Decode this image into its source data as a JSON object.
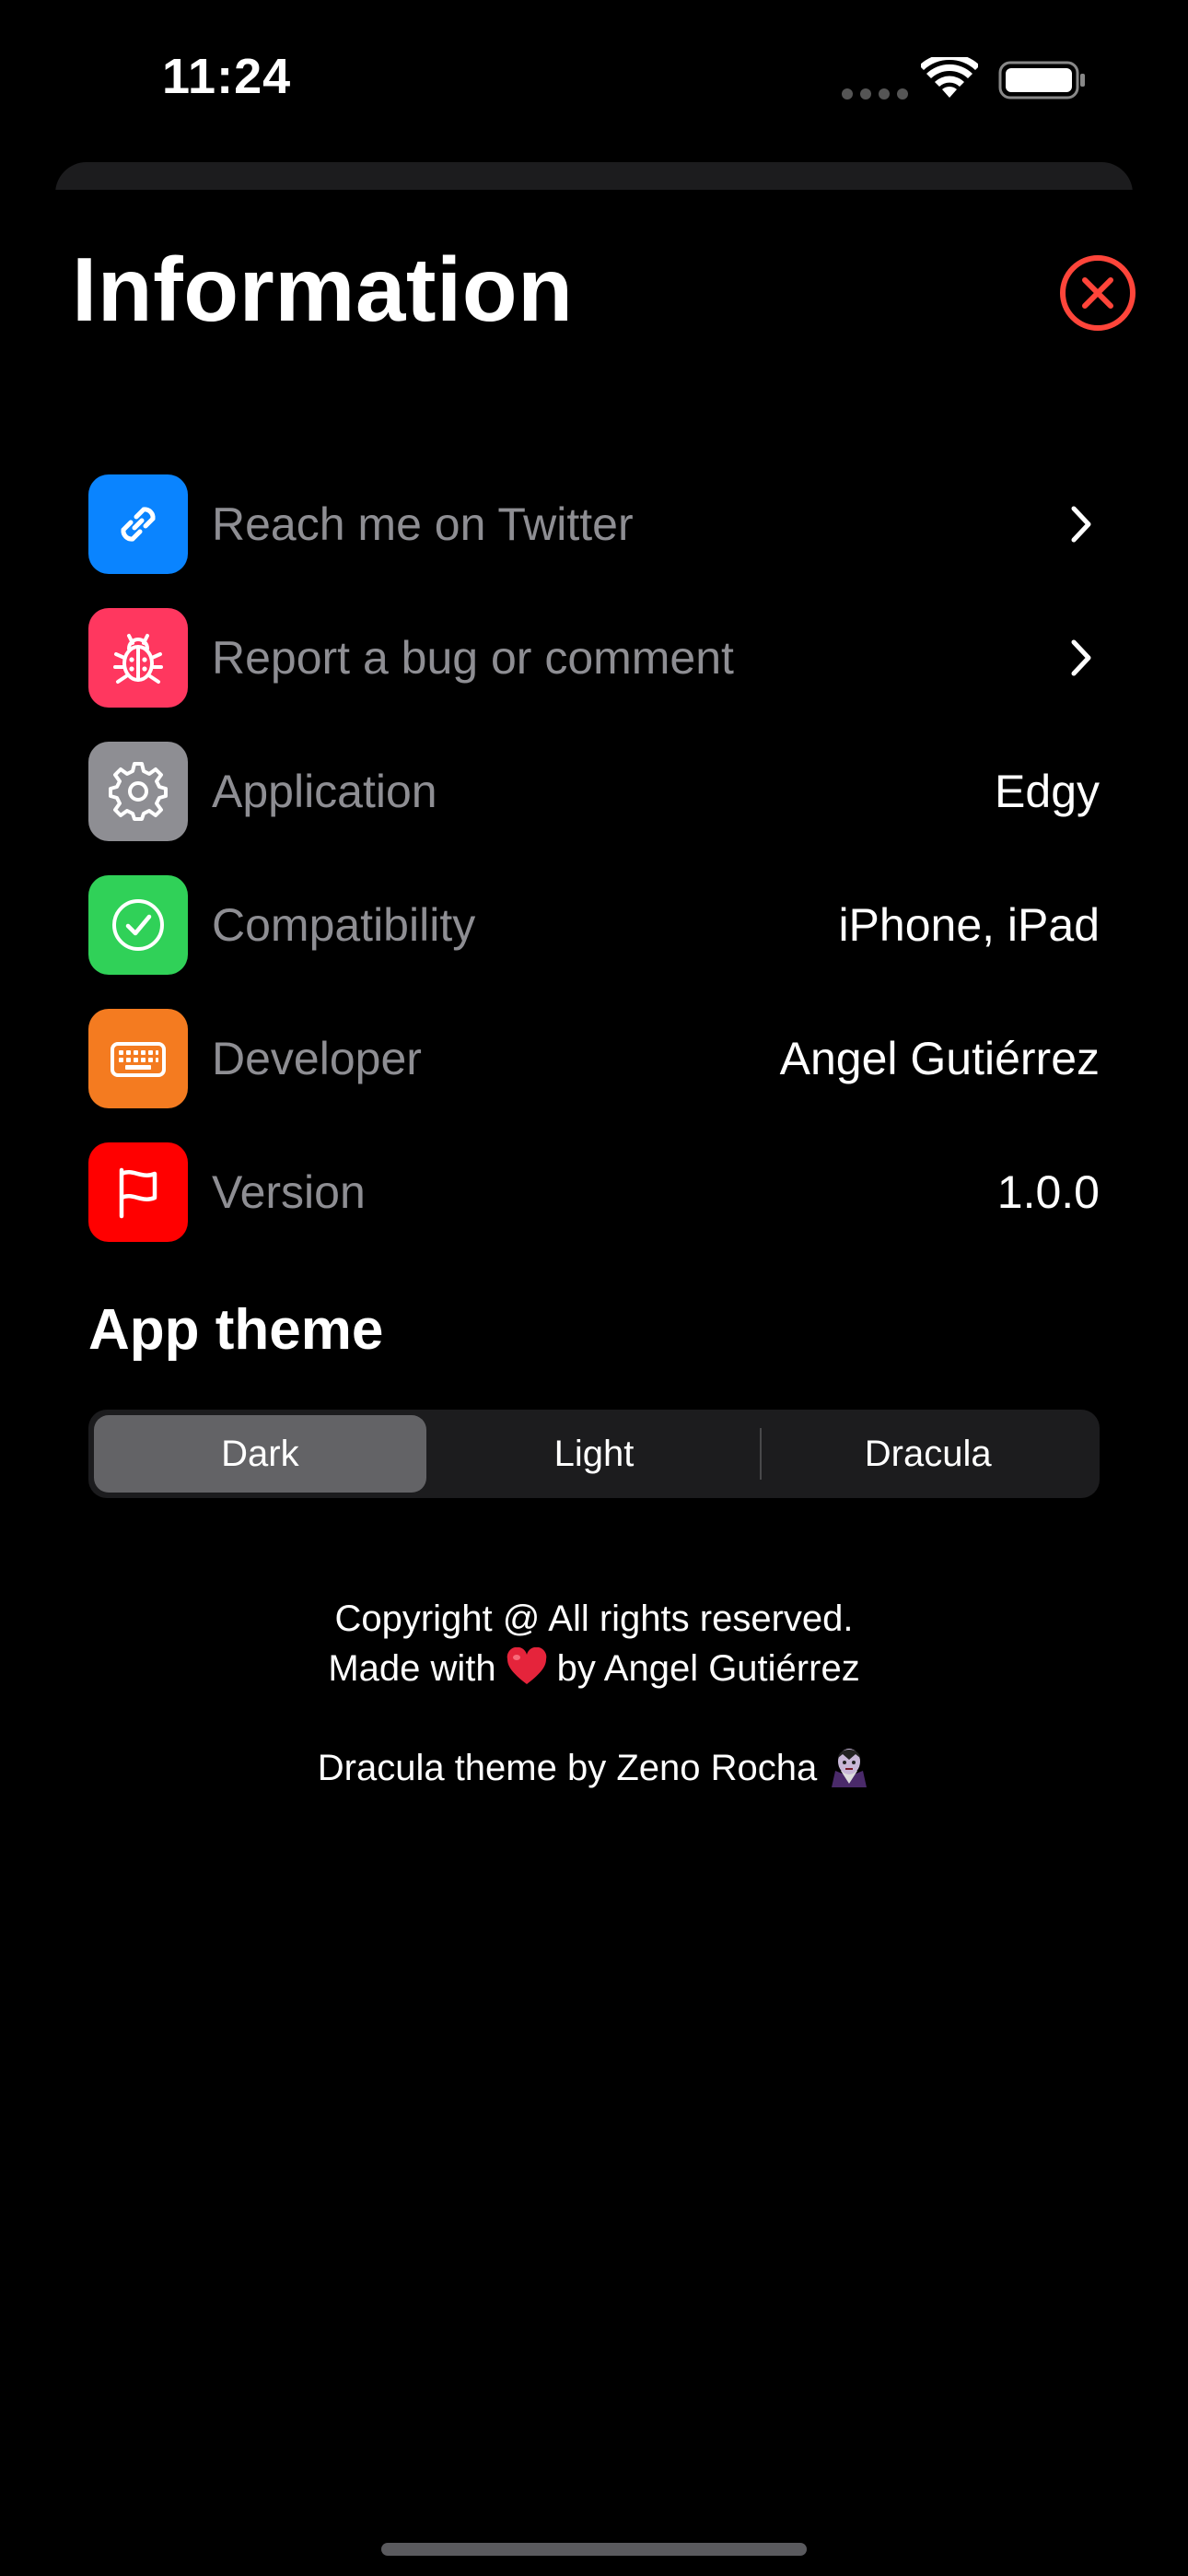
{
  "status_bar": {
    "time": "11:24",
    "icons": [
      "signal-dots-icon",
      "wifi-icon",
      "battery-icon"
    ]
  },
  "header": {
    "title": "Information",
    "close_icon": "xmark-circle-icon"
  },
  "rows": [
    {
      "label": "Reach me on Twitter",
      "value": "",
      "icon": "link-icon",
      "color": "#0a84ff",
      "chevron": true
    },
    {
      "label": "Report a bug or comment",
      "value": "",
      "icon": "ladybug-icon",
      "color": "#ff375f",
      "chevron": true
    },
    {
      "label": "Application",
      "value": "Edgy",
      "icon": "gear-icon",
      "color": "#8e8e93",
      "chevron": false
    },
    {
      "label": "Compatibility",
      "value": "iPhone, iPad",
      "icon": "checkmark-circle-icon",
      "color": "#30d158",
      "chevron": false
    },
    {
      "label": "Developer",
      "value": "Angel Gutiérrez",
      "icon": "keyboard-icon",
      "color": "#f47b20",
      "chevron": false
    },
    {
      "label": "Version",
      "value": "1.0.0",
      "icon": "flag-icon",
      "color": "#ff0000",
      "chevron": false
    }
  ],
  "theme": {
    "title": "App theme",
    "options": [
      "Dark",
      "Light",
      "Dracula"
    ],
    "selected": "Dark"
  },
  "footer": {
    "copyright": "Copyright @ All rights reserved.",
    "made_with_prefix": "Made with",
    "made_with_suffix": "by Angel Gutiérrez",
    "dracula_credit": "Dracula theme by Zeno Rocha"
  },
  "colors": {
    "close_red": "#ff453a",
    "label_gray": "#8e8e93",
    "segment_selected": "#636366"
  }
}
